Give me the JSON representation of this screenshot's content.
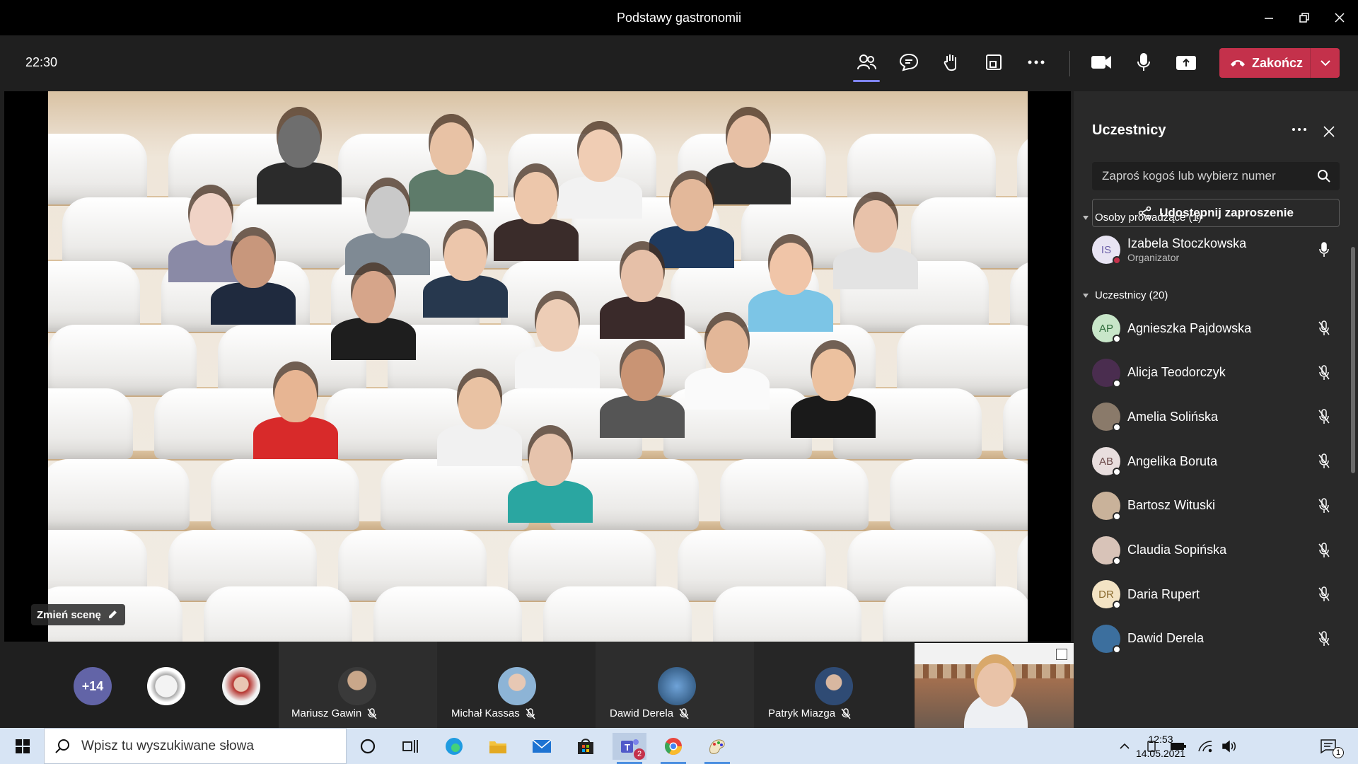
{
  "window": {
    "title": "Podstawy gastronomii"
  },
  "meeting": {
    "timer": "22:30",
    "end_label": "Zakończ",
    "change_scene_label": "Zmień scenę"
  },
  "panel": {
    "title": "Uczestnicy",
    "search_placeholder": "Zaproś kogoś lub wybierz numer",
    "share_label": "Udostępnij zaproszenie",
    "presenters_header": "Osoby prowadzące (1)",
    "attendees_header": "Uczestnicy (20)",
    "organizer": {
      "name": "Izabela Stoczkowska",
      "role": "Organizator",
      "initials": "IS"
    },
    "attendees": [
      {
        "name": "Agnieszka Pajdowska",
        "initials": "AP",
        "color": "#c8e6c9",
        "text": "#2e6b3a"
      },
      {
        "name": "Alicja Teodorczyk",
        "initials": "",
        "color": "#4a2d4f",
        "text": "#fff"
      },
      {
        "name": "Amelia Solińska",
        "initials": "",
        "color": "#8a7a6a",
        "text": "#fff"
      },
      {
        "name": "Angelika Boruta",
        "initials": "AB",
        "color": "#e8dede",
        "text": "#6b4a4a"
      },
      {
        "name": "Bartosz Wituski",
        "initials": "",
        "color": "#c9b29a",
        "text": "#fff"
      },
      {
        "name": "Claudia Sopińska",
        "initials": "",
        "color": "#d8c3b8",
        "text": "#fff"
      },
      {
        "name": "Daria Rupert",
        "initials": "DR",
        "color": "#f3e3c4",
        "text": "#8a6a2e"
      },
      {
        "name": "Dawid Derela",
        "initials": "",
        "color": "#3c6f9e",
        "text": "#fff"
      }
    ]
  },
  "strip": {
    "overflow_count": "+14",
    "tiles": [
      {
        "name": "Mariusz Gawin"
      },
      {
        "name": "Michał Kassas"
      },
      {
        "name": "Dawid Derela"
      },
      {
        "name": "Patryk Miazga"
      }
    ]
  },
  "taskbar": {
    "search_placeholder": "Wpisz tu wyszukiwane słowa",
    "time": "12:53",
    "date": "14.05.2021",
    "teams_badge": "2",
    "notif_badge": "1"
  }
}
